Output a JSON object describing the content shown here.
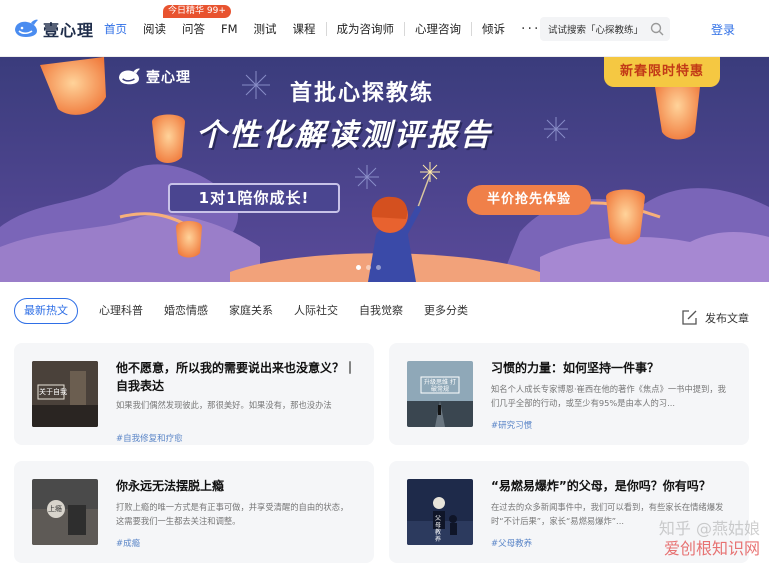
{
  "brand": {
    "name": "壹心理"
  },
  "nav": {
    "items": [
      "首页",
      "阅读",
      "问答",
      "FM",
      "测试",
      "课程",
      "成为咨询师",
      "心理咨询",
      "倾诉"
    ],
    "badge": "今日精华 99+",
    "more": "···"
  },
  "search": {
    "value": "试试搜索「心探教练」"
  },
  "header": {
    "login": "登录"
  },
  "banner": {
    "brand": "壹心理",
    "promo_tag": "新春限时特惠",
    "title_line1": "首批心探教练",
    "title_line2": "个性化解读测评报告",
    "pill_text": "1对1陪你成长!",
    "cta_label": "半价抢先体验"
  },
  "categories": [
    "最新热文",
    "心理科普",
    "婚恋情感",
    "家庭关系",
    "人际社交",
    "自我觉察",
    "更多分类"
  ],
  "publish": {
    "label": "发布文章"
  },
  "articles": [
    {
      "title": "他不愿意，所以我的需要说出来也没意义？｜自我表达",
      "desc": "如果我们偶然发现彼此，那很美好。如果没有，那也没办法",
      "tag": "#自我修复和疗愈",
      "thumb_text": "关于自我"
    },
    {
      "title": "习惯的力量：如何坚持一件事？",
      "desc": "知名个人成长专家博恩·崔西在他的著作《焦点》一书中提到，我们几乎全部的行动，或至少有95%是由本人的习...",
      "tag": "#研究习惯",
      "thumb_text": "升级思维 打破常规"
    },
    {
      "title": "你永远无法摆脱上瘾",
      "desc": "打败上瘾的唯一方式是有正事可做，并享受清醒的自由的状态，这需要我们一生都去关注和调整。",
      "tag": "#成瘾",
      "thumb_text": "上瘾"
    },
    {
      "title": "“易燃易爆炸”的父母，是你吗？你有吗？",
      "desc": "在过去的众多新闻事件中，我们可以看到，有些家长在情绪爆发时“不计后果”，家长“易燃易爆炸”...",
      "tag": "#父母教养",
      "thumb_text": "父母 教养"
    }
  ],
  "watermark": {
    "line1": "知乎 @燕姑娘",
    "line2": "爱创根知识网"
  },
  "colors": {
    "accent": "#2f6fe6",
    "badge": "#e8532f",
    "promo": "#f5c842",
    "cta": "#f08049",
    "card_bg": "#f5f6f8"
  }
}
